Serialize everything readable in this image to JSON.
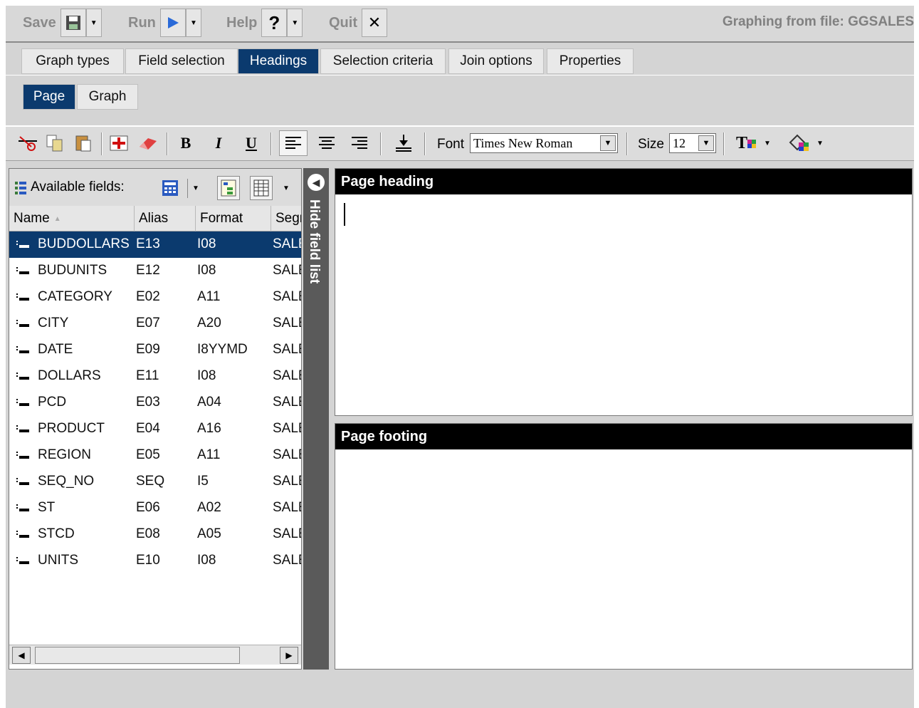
{
  "menubar": {
    "save_label": "Save",
    "run_label": "Run",
    "help_label": "Help",
    "quit_label": "Quit",
    "file_title": "Graphing from file: GGSALES"
  },
  "tabs": [
    "Graph types",
    "Field selection",
    "Headings",
    "Selection criteria",
    "Join options",
    "Properties"
  ],
  "active_tab": "Headings",
  "subtabs": [
    "Page",
    "Graph"
  ],
  "active_subtab": "Page",
  "toolbar": {
    "bold_label": "B",
    "italic_label": "I",
    "underline_label": "U",
    "font_label": "Font",
    "font_value": "Times New Roman",
    "size_label": "Size",
    "size_value": "12",
    "text_color_label": "T"
  },
  "fieldpanel": {
    "title": "Available fields:",
    "columns": [
      "Name",
      "Alias",
      "Format",
      "Segment"
    ],
    "sort_indicator": "▲",
    "selected_index": 0,
    "rows": [
      {
        "name": "BUDDOLLARS",
        "alias": "E13",
        "format": "I08",
        "segment": "SALES"
      },
      {
        "name": "BUDUNITS",
        "alias": "E12",
        "format": "I08",
        "segment": "SALES"
      },
      {
        "name": "CATEGORY",
        "alias": "E02",
        "format": "A11",
        "segment": "SALES"
      },
      {
        "name": "CITY",
        "alias": "E07",
        "format": "A20",
        "segment": "SALES"
      },
      {
        "name": "DATE",
        "alias": "E09",
        "format": "I8YYMD",
        "segment": "SALES"
      },
      {
        "name": "DOLLARS",
        "alias": "E11",
        "format": "I08",
        "segment": "SALES"
      },
      {
        "name": "PCD",
        "alias": "E03",
        "format": "A04",
        "segment": "SALES"
      },
      {
        "name": "PRODUCT",
        "alias": "E04",
        "format": "A16",
        "segment": "SALES"
      },
      {
        "name": "REGION",
        "alias": "E05",
        "format": "A11",
        "segment": "SALES"
      },
      {
        "name": "SEQ_NO",
        "alias": "SEQ",
        "format": "I5",
        "segment": "SALES"
      },
      {
        "name": "ST",
        "alias": "E06",
        "format": "A02",
        "segment": "SALES"
      },
      {
        "name": "STCD",
        "alias": "E08",
        "format": "A05",
        "segment": "SALES"
      },
      {
        "name": "UNITS",
        "alias": "E10",
        "format": "I08",
        "segment": "SALES"
      }
    ]
  },
  "hide_field_list_label": "Hide field list",
  "page_heading": {
    "title": "Page heading",
    "content": ""
  },
  "page_footing": {
    "title": "Page footing",
    "content": ""
  },
  "colors": {
    "active_tab": "#0b3a6e",
    "editor_header": "#000000",
    "strip": "#5a5a5a"
  }
}
